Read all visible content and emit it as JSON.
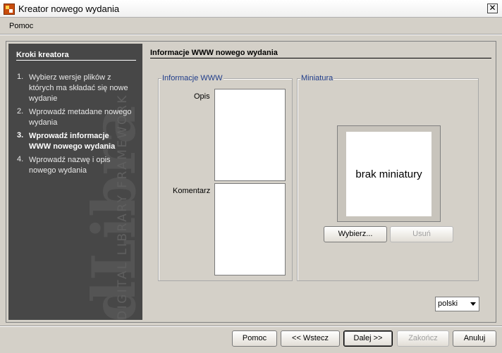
{
  "window": {
    "title": "Kreator nowego wydania",
    "close_symbol": "✕"
  },
  "menu": {
    "items": [
      "Pomoc"
    ]
  },
  "steps": {
    "title": "Kroki kreatora",
    "watermark_logo": "dLibra",
    "watermark_text": "DIGITAL LIBRARY FRAMEWORK",
    "items": [
      {
        "num": "1.",
        "lines": [
          "Wybierz wersje plików z",
          "których ma składać się nowe",
          "wydanie"
        ]
      },
      {
        "num": "2.",
        "lines": [
          "Wprowadź metadane nowego",
          "wydania"
        ]
      },
      {
        "num": "3.",
        "lines": [
          "Wprowadź informacje",
          "WWW nowego wydania"
        ]
      },
      {
        "num": "4.",
        "lines": [
          "Wprowadź nazwę i opis",
          "nowego wydania"
        ]
      }
    ],
    "current_index": 3
  },
  "main": {
    "title": "Informacje WWW nowego wydania",
    "www_group": {
      "label": "Informacje WWW",
      "opis_label": "Opis",
      "komentarz_label": "Komentarz"
    },
    "thumb_group": {
      "label": "Miniatura",
      "placeholder": "brak miniatury",
      "choose_button": "Wybierz...",
      "remove_button": "Usuń"
    },
    "language": {
      "selected": "polski"
    }
  },
  "footer": {
    "help": "Pomoc",
    "back": "<< Wstecz",
    "next": "Dalej >>",
    "finish": "Zakończ",
    "cancel": "Anuluj"
  }
}
